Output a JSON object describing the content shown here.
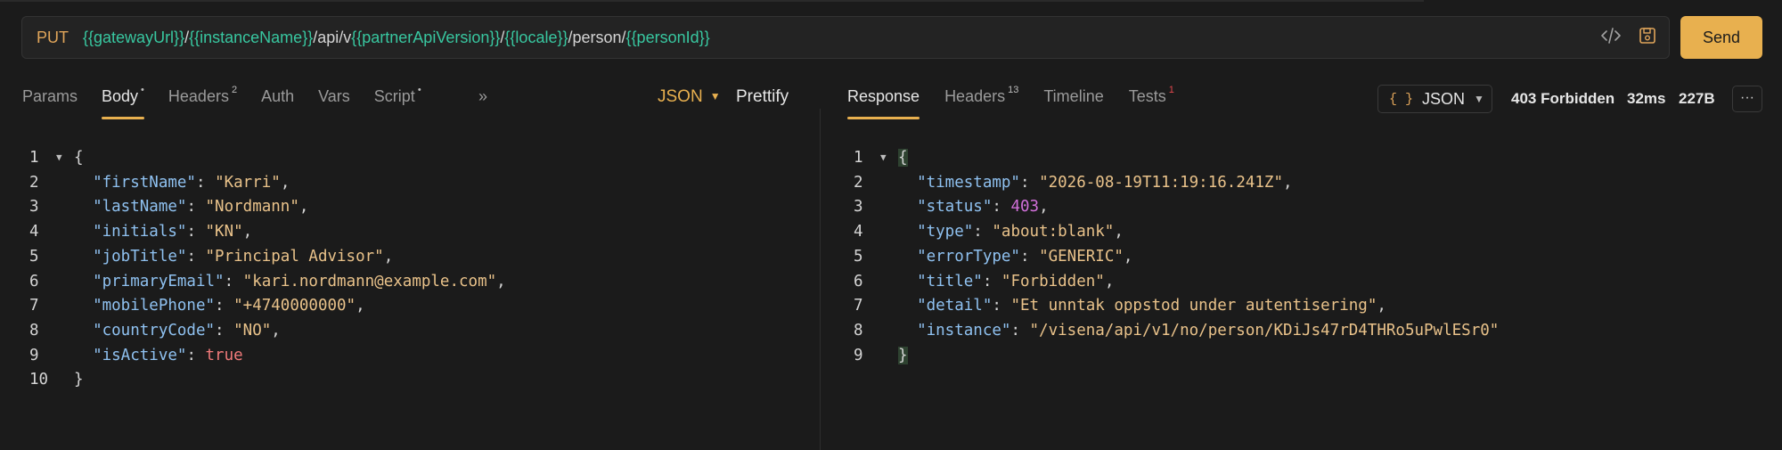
{
  "request": {
    "method": "PUT",
    "url_parts": [
      {
        "type": "var",
        "text": "{{gatewayUrl}}"
      },
      {
        "type": "txt",
        "text": "/"
      },
      {
        "type": "var",
        "text": "{{instanceName}}"
      },
      {
        "type": "txt",
        "text": "/api/v"
      },
      {
        "type": "var",
        "text": "{{partnerApiVersion}}"
      },
      {
        "type": "txt",
        "text": "/"
      },
      {
        "type": "var",
        "text": "{{locale}}"
      },
      {
        "type": "txt",
        "text": "/person/"
      },
      {
        "type": "var",
        "text": "{{personId}}"
      }
    ],
    "send_label": "Send"
  },
  "request_tabs": [
    {
      "label": "Params",
      "badge": "",
      "active": false
    },
    {
      "label": "Body",
      "badge": "•",
      "active": true
    },
    {
      "label": "Headers",
      "badge": "2",
      "active": false
    },
    {
      "label": "Auth",
      "badge": "",
      "active": false
    },
    {
      "label": "Vars",
      "badge": "",
      "active": false
    },
    {
      "label": "Script",
      "badge": "•",
      "active": false
    }
  ],
  "request_tabs_more": "»",
  "body_format": "JSON",
  "prettify_label": "Prettify",
  "request_body": [
    [
      {
        "c": "p",
        "t": "{"
      }
    ],
    [
      {
        "c": "p",
        "t": "  "
      },
      {
        "c": "k",
        "t": "\"firstName\""
      },
      {
        "c": "p",
        "t": ": "
      },
      {
        "c": "s",
        "t": "\"Karri\""
      },
      {
        "c": "p",
        "t": ","
      }
    ],
    [
      {
        "c": "p",
        "t": "  "
      },
      {
        "c": "k",
        "t": "\"lastName\""
      },
      {
        "c": "p",
        "t": ": "
      },
      {
        "c": "s",
        "t": "\"Nordmann\""
      },
      {
        "c": "p",
        "t": ","
      }
    ],
    [
      {
        "c": "p",
        "t": "  "
      },
      {
        "c": "k",
        "t": "\"initials\""
      },
      {
        "c": "p",
        "t": ": "
      },
      {
        "c": "s",
        "t": "\"KN\""
      },
      {
        "c": "p",
        "t": ","
      }
    ],
    [
      {
        "c": "p",
        "t": "  "
      },
      {
        "c": "k",
        "t": "\"jobTitle\""
      },
      {
        "c": "p",
        "t": ": "
      },
      {
        "c": "s",
        "t": "\"Principal Advisor\""
      },
      {
        "c": "p",
        "t": ","
      }
    ],
    [
      {
        "c": "p",
        "t": "  "
      },
      {
        "c": "k",
        "t": "\"primaryEmail\""
      },
      {
        "c": "p",
        "t": ": "
      },
      {
        "c": "s",
        "t": "\"kari.nordmann@example.com\""
      },
      {
        "c": "p",
        "t": ","
      }
    ],
    [
      {
        "c": "p",
        "t": "  "
      },
      {
        "c": "k",
        "t": "\"mobilePhone\""
      },
      {
        "c": "p",
        "t": ": "
      },
      {
        "c": "s",
        "t": "\"+4740000000\""
      },
      {
        "c": "p",
        "t": ","
      }
    ],
    [
      {
        "c": "p",
        "t": "  "
      },
      {
        "c": "k",
        "t": "\"countryCode\""
      },
      {
        "c": "p",
        "t": ": "
      },
      {
        "c": "s",
        "t": "\"NO\""
      },
      {
        "c": "p",
        "t": ","
      }
    ],
    [
      {
        "c": "p",
        "t": "  "
      },
      {
        "c": "k",
        "t": "\"isActive\""
      },
      {
        "c": "p",
        "t": ": "
      },
      {
        "c": "b",
        "t": "true"
      }
    ],
    [
      {
        "c": "p",
        "t": "}"
      }
    ]
  ],
  "response_tabs": [
    {
      "label": "Response",
      "badge": "",
      "active": true
    },
    {
      "label": "Headers",
      "badge": "13",
      "active": false
    },
    {
      "label": "Timeline",
      "badge": "",
      "active": false
    },
    {
      "label": "Tests",
      "badge": "1",
      "active": false,
      "badge_red": true
    }
  ],
  "response_format": "JSON",
  "response_status": {
    "code": "403 Forbidden",
    "time": "32ms",
    "size": "227B"
  },
  "more_label": "···",
  "response_body": [
    [
      {
        "c": "hl",
        "t": "{"
      }
    ],
    [
      {
        "c": "p",
        "t": "  "
      },
      {
        "c": "k",
        "t": "\"timestamp\""
      },
      {
        "c": "p",
        "t": ": "
      },
      {
        "c": "s",
        "t": "\"2026-08-19T11:19:16.241Z\""
      },
      {
        "c": "p",
        "t": ","
      }
    ],
    [
      {
        "c": "p",
        "t": "  "
      },
      {
        "c": "k",
        "t": "\"status\""
      },
      {
        "c": "p",
        "t": ": "
      },
      {
        "c": "n",
        "t": "403"
      },
      {
        "c": "p",
        "t": ","
      }
    ],
    [
      {
        "c": "p",
        "t": "  "
      },
      {
        "c": "k",
        "t": "\"type\""
      },
      {
        "c": "p",
        "t": ": "
      },
      {
        "c": "s",
        "t": "\"about:blank\""
      },
      {
        "c": "p",
        "t": ","
      }
    ],
    [
      {
        "c": "p",
        "t": "  "
      },
      {
        "c": "k",
        "t": "\"errorType\""
      },
      {
        "c": "p",
        "t": ": "
      },
      {
        "c": "s",
        "t": "\"GENERIC\""
      },
      {
        "c": "p",
        "t": ","
      }
    ],
    [
      {
        "c": "p",
        "t": "  "
      },
      {
        "c": "k",
        "t": "\"title\""
      },
      {
        "c": "p",
        "t": ": "
      },
      {
        "c": "s",
        "t": "\"Forbidden\""
      },
      {
        "c": "p",
        "t": ","
      }
    ],
    [
      {
        "c": "p",
        "t": "  "
      },
      {
        "c": "k",
        "t": "\"detail\""
      },
      {
        "c": "p",
        "t": ": "
      },
      {
        "c": "s",
        "t": "\"Et unntak oppstod under autentisering\""
      },
      {
        "c": "p",
        "t": ","
      }
    ],
    [
      {
        "c": "p",
        "t": "  "
      },
      {
        "c": "k",
        "t": "\"instance\""
      },
      {
        "c": "p",
        "t": ": "
      },
      {
        "c": "s",
        "t": "\"/visena/api/v1/no/person/KDiJs47rD4THRo5uPwlESr0\""
      }
    ],
    [
      {
        "c": "hl",
        "t": "}"
      }
    ]
  ],
  "colors": {
    "accent": "#e8b04f",
    "variable": "#38c7a0",
    "method": "#e0a55a",
    "json_key": "#8fc1f0",
    "json_string": "#e9c28a",
    "json_number": "#d170d9",
    "json_boolean": "#f07a7a"
  },
  "icons": {
    "code": "code-icon",
    "save": "save-icon",
    "fold": "fold-caret-icon",
    "dropdown": "caret-down-icon"
  }
}
